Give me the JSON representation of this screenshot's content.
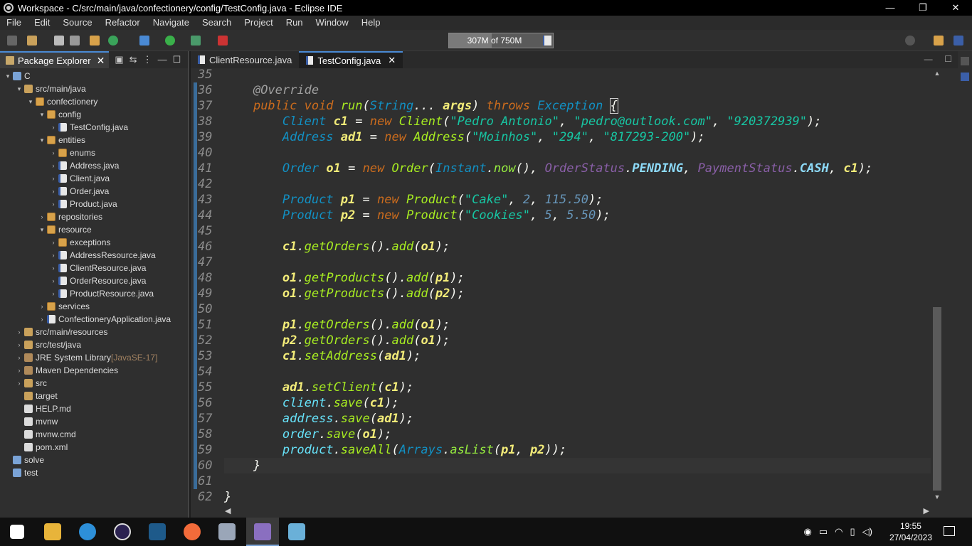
{
  "window": {
    "title": "Workspace - C/src/main/java/confectionery/config/TestConfig.java - Eclipse IDE",
    "minimize": "—",
    "restore": "❐",
    "close": "✕"
  },
  "menu": [
    "File",
    "Edit",
    "Source",
    "Refactor",
    "Navigate",
    "Search",
    "Project",
    "Run",
    "Window",
    "Help"
  ],
  "heap": {
    "label": "307M of 750M",
    "used_fraction": 0.41
  },
  "explorer": {
    "tab_label": "Package Explorer",
    "items": [
      {
        "label": "C",
        "arrow": "v",
        "icon": "project"
      },
      {
        "label": "src/main/java",
        "arrow": "v",
        "icon": "folder"
      },
      {
        "label": "confectionery",
        "arrow": "v",
        "icon": "package"
      },
      {
        "label": "config",
        "arrow": "v",
        "icon": "package"
      },
      {
        "label": "TestConfig.java",
        "arrow": ">",
        "icon": "java"
      },
      {
        "label": "entities",
        "arrow": "v",
        "icon": "package"
      },
      {
        "label": "enums",
        "arrow": ">",
        "icon": "package"
      },
      {
        "label": "Address.java",
        "arrow": ">",
        "icon": "java"
      },
      {
        "label": "Client.java",
        "arrow": ">",
        "icon": "java"
      },
      {
        "label": "Order.java",
        "arrow": ">",
        "icon": "java"
      },
      {
        "label": "Product.java",
        "arrow": ">",
        "icon": "java"
      },
      {
        "label": "repositories",
        "arrow": ">",
        "icon": "package"
      },
      {
        "label": "resource",
        "arrow": "v",
        "icon": "package"
      },
      {
        "label": "exceptions",
        "arrow": ">",
        "icon": "package"
      },
      {
        "label": "AddressResource.java",
        "arrow": ">",
        "icon": "java"
      },
      {
        "label": "ClientResource.java",
        "arrow": ">",
        "icon": "java"
      },
      {
        "label": "OrderResource.java",
        "arrow": ">",
        "icon": "java"
      },
      {
        "label": "ProductResource.java",
        "arrow": ">",
        "icon": "java"
      },
      {
        "label": "services",
        "arrow": ">",
        "icon": "package"
      },
      {
        "label": "ConfectioneryApplication.java",
        "arrow": ">",
        "icon": "java"
      },
      {
        "label": "src/main/resources",
        "arrow": ">",
        "icon": "folder"
      },
      {
        "label": "src/test/java",
        "arrow": ">",
        "icon": "folder"
      },
      {
        "label": "JRE System Library",
        "suffix": "[JavaSE-17]",
        "arrow": ">",
        "icon": "library"
      },
      {
        "label": "Maven Dependencies",
        "arrow": ">",
        "icon": "library"
      },
      {
        "label": "src",
        "arrow": ">",
        "icon": "folder"
      },
      {
        "label": "target",
        "arrow": "",
        "icon": "folder"
      },
      {
        "label": "HELP.md",
        "arrow": "",
        "icon": "file"
      },
      {
        "label": "mvnw",
        "arrow": "",
        "icon": "file"
      },
      {
        "label": "mvnw.cmd",
        "arrow": "",
        "icon": "file"
      },
      {
        "label": "pom.xml",
        "arrow": "",
        "icon": "file"
      },
      {
        "label": "solve",
        "arrow": "",
        "icon": "project"
      },
      {
        "label": "test",
        "arrow": "",
        "icon": "project"
      }
    ]
  },
  "editor": {
    "tabs": [
      {
        "label": "ClientResource.java",
        "active": false
      },
      {
        "label": "TestConfig.java",
        "active": true
      }
    ],
    "lines": [
      {
        "num": "35",
        "html": ""
      },
      {
        "num": "36",
        "html": "    <span class=\"a\">@Override</span>"
      },
      {
        "num": "37",
        "html": "    <span class=\"k\">public void</span> <span class=\"m\">run</span><span class=\"p\">(</span><span class=\"t\">String</span><span class=\"p\">...</span> <span class=\"v\">args</span><span class=\"p\">)</span> <span class=\"k\">throws</span> <span class=\"t\">Exception</span> <span class=\"p brk\">{</span>"
      },
      {
        "num": "38",
        "html": "        <span class=\"t\">Client</span> <span class=\"v\">c1</span> <span class=\"p\">=</span> <span class=\"k\">new</span> <span class=\"m\">Client</span><span class=\"p\">(</span><span class=\"s\">\"Pedro Antonio\"</span><span class=\"p\">,</span> <span class=\"s\">\"pedro@outlook.com\"</span><span class=\"p\">,</span> <span class=\"s\">\"920372939\"</span><span class=\"p\">);</span>"
      },
      {
        "num": "39",
        "html": "        <span class=\"t\">Address</span> <span class=\"v\">ad1</span> <span class=\"p\">=</span> <span class=\"k\">new</span> <span class=\"m\">Address</span><span class=\"p\">(</span><span class=\"s\">\"Moinhos\"</span><span class=\"p\">,</span> <span class=\"s\">\"294\"</span><span class=\"p\">,</span> <span class=\"s\">\"817293-200\"</span><span class=\"p\">);</span>"
      },
      {
        "num": "40",
        "html": ""
      },
      {
        "num": "41",
        "html": "        <span class=\"t\">Order</span> <span class=\"v\">o1</span> <span class=\"p\">=</span> <span class=\"k\">new</span> <span class=\"m\">Order</span><span class=\"p\">(</span><span class=\"t\">Instant</span><span class=\"p\">.</span><span class=\"sm\">now</span><span class=\"p\">(),</span> <span class=\"e\">OrderStatus</span><span class=\"p\">.</span><span class=\"cst\">PENDING</span><span class=\"p\">,</span> <span class=\"e\">PaymentStatus</span><span class=\"p\">.</span><span class=\"cst\">CASH</span><span class=\"p\">,</span> <span class=\"v\">c1</span><span class=\"p\">);</span>"
      },
      {
        "num": "42",
        "html": ""
      },
      {
        "num": "43",
        "html": "        <span class=\"t\">Product</span> <span class=\"v\">p1</span> <span class=\"p\">=</span> <span class=\"k\">new</span> <span class=\"m\">Product</span><span class=\"p\">(</span><span class=\"s\">\"Cake\"</span><span class=\"p\">,</span> <span class=\"n\">2</span><span class=\"p\">,</span> <span class=\"n\">115.50</span><span class=\"p\">);</span>"
      },
      {
        "num": "44",
        "html": "        <span class=\"t\">Product</span> <span class=\"v\">p2</span> <span class=\"p\">=</span> <span class=\"k\">new</span> <span class=\"m\">Product</span><span class=\"p\">(</span><span class=\"s\">\"Cookies\"</span><span class=\"p\">,</span> <span class=\"n\">5</span><span class=\"p\">,</span> <span class=\"n\">5.50</span><span class=\"p\">);</span>"
      },
      {
        "num": "45",
        "html": ""
      },
      {
        "num": "46",
        "html": "        <span class=\"v\">c1</span><span class=\"p\">.</span><span class=\"m\">getOrders</span><span class=\"p\">().</span><span class=\"m\">add</span><span class=\"p\">(</span><span class=\"v\">o1</span><span class=\"p\">);</span>"
      },
      {
        "num": "47",
        "html": ""
      },
      {
        "num": "48",
        "html": "        <span class=\"v\">o1</span><span class=\"p\">.</span><span class=\"m\">getProducts</span><span class=\"p\">().</span><span class=\"m\">add</span><span class=\"p\">(</span><span class=\"v\">p1</span><span class=\"p\">);</span>"
      },
      {
        "num": "49",
        "html": "        <span class=\"v\">o1</span><span class=\"p\">.</span><span class=\"m\">getProducts</span><span class=\"p\">().</span><span class=\"m\">add</span><span class=\"p\">(</span><span class=\"v\">p2</span><span class=\"p\">);</span>"
      },
      {
        "num": "50",
        "html": ""
      },
      {
        "num": "51",
        "html": "        <span class=\"v\">p1</span><span class=\"p\">.</span><span class=\"m\">getOrders</span><span class=\"p\">().</span><span class=\"m\">add</span><span class=\"p\">(</span><span class=\"v\">o1</span><span class=\"p\">);</span>"
      },
      {
        "num": "52",
        "html": "        <span class=\"v\">p2</span><span class=\"p\">.</span><span class=\"m\">getOrders</span><span class=\"p\">().</span><span class=\"m\">add</span><span class=\"p\">(</span><span class=\"v\">o1</span><span class=\"p\">);</span>"
      },
      {
        "num": "53",
        "html": "        <span class=\"v\">c1</span><span class=\"p\">.</span><span class=\"m\">setAddress</span><span class=\"p\">(</span><span class=\"v\">ad1</span><span class=\"p\">);</span>"
      },
      {
        "num": "54",
        "html": ""
      },
      {
        "num": "55",
        "html": "        <span class=\"v\">ad1</span><span class=\"p\">.</span><span class=\"m\">setClient</span><span class=\"p\">(</span><span class=\"v\">c1</span><span class=\"p\">);</span>"
      },
      {
        "num": "56",
        "html": "        <span class=\"f\">client</span><span class=\"p\">.</span><span class=\"m\">save</span><span class=\"p\">(</span><span class=\"v\">c1</span><span class=\"p\">);</span>"
      },
      {
        "num": "57",
        "html": "        <span class=\"f\">address</span><span class=\"p\">.</span><span class=\"m\">save</span><span class=\"p\">(</span><span class=\"v\">ad1</span><span class=\"p\">);</span>"
      },
      {
        "num": "58",
        "html": "        <span class=\"f\">order</span><span class=\"p\">.</span><span class=\"m\">save</span><span class=\"p\">(</span><span class=\"v\">o1</span><span class=\"p\">);</span>"
      },
      {
        "num": "59",
        "html": "        <span class=\"f\">product</span><span class=\"p\">.</span><span class=\"m\">saveAll</span><span class=\"p\">(</span><span class=\"t\">Arrays</span><span class=\"p\">.</span><span class=\"sm\">asList</span><span class=\"p\">(</span><span class=\"v\">p1</span><span class=\"p\">,</span> <span class=\"v\">p2</span><span class=\"p\">));</span>"
      },
      {
        "num": "60",
        "html": "    <span class=\"p\">}</span>"
      },
      {
        "num": "61",
        "html": ""
      },
      {
        "num": "62",
        "html": "<span class=\"p\">}</span>"
      }
    ],
    "current_line": "60"
  },
  "taskbar": {
    "time": "19:55",
    "date": "27/04/2023",
    "icons": [
      "windows-start-icon",
      "file-explorer-icon",
      "edge-icon",
      "eclipse-icon",
      "vscode-icon",
      "postman-icon",
      "remote-desktop-icon",
      "eclipse-ide-icon",
      "notes-icon"
    ]
  }
}
